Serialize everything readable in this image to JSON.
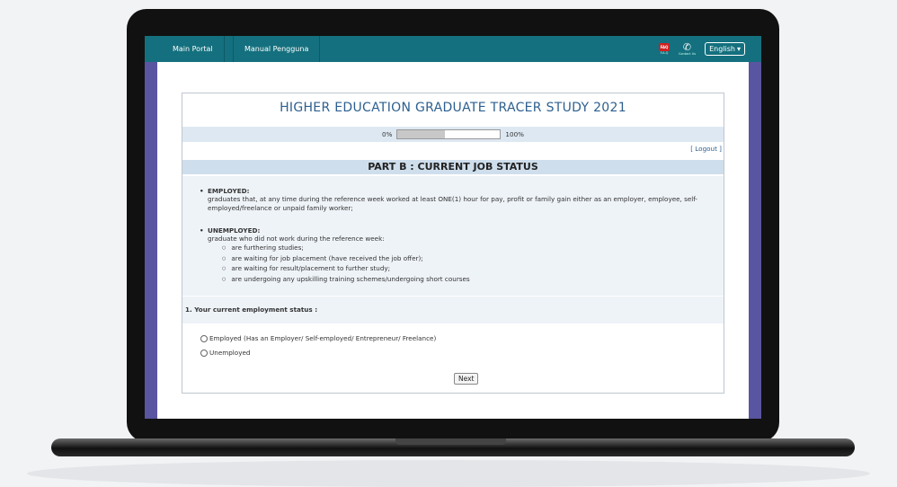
{
  "topbar": {
    "nav_items": [
      "Main Portal",
      "Manual Pengguna"
    ],
    "faq_badge": "FAQ",
    "faq_label": "F.A.Q",
    "contact_label": "Contact Us",
    "language": "English"
  },
  "survey": {
    "title": "HIGHER EDUCATION GRADUATE TRACER STUDY 2021",
    "progress": {
      "start_label": "0%",
      "end_label": "100%",
      "value_fraction": 0.46
    },
    "logout_label": "[ Logout ]",
    "section_title": "PART B : CURRENT JOB STATUS",
    "definitions": [
      {
        "term": "EMPLOYED:",
        "text": "graduates that, at any time during the reference week worked at least ONE(1) hour for pay, profit or family gain either as an employer, employee, self-employed/freelance or unpaid family worker;"
      },
      {
        "term": "UNEMPLOYED:",
        "text": "graduate who did not work during the reference week:",
        "items": [
          "are furthering studies;",
          "are waiting for job placement (have received the job offer);",
          "are waiting for result/placement to further study;",
          "are undergoing any upskilling training schemes/undergoing short courses"
        ]
      }
    ],
    "question": "1. Your current employment status :",
    "options": [
      "Employed (Has an Employer/ Self-employed/ Entrepreneur/ Freelance)",
      "Unemployed"
    ],
    "next_label": "Next"
  }
}
